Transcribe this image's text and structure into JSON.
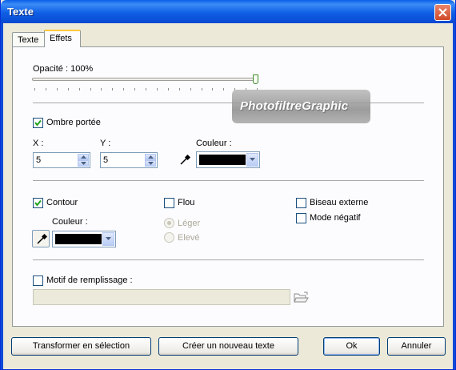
{
  "window": {
    "title": "Texte"
  },
  "tabs": [
    {
      "label": "Texte"
    },
    {
      "label": "Effets"
    }
  ],
  "opacity": {
    "label": "Opacité : 100%",
    "value_percent": 100
  },
  "watermark": {
    "text": "PhotofiltreGraphic"
  },
  "shadow": {
    "checkbox_label": "Ombre portée",
    "checked": true,
    "x_label": "X :",
    "x_value": "5",
    "y_label": "Y :",
    "y_value": "5",
    "color_label": "Couleur :",
    "color": "#000000"
  },
  "outline": {
    "checkbox_label": "Contour",
    "checked": true,
    "color_label": "Couleur :",
    "color": "#000000"
  },
  "blur": {
    "checkbox_label": "Flou",
    "checked": false,
    "options": [
      {
        "label": "Léger"
      },
      {
        "label": "Elevé"
      }
    ]
  },
  "bevel": {
    "checkbox_label": "Biseau externe",
    "checked": false
  },
  "negative": {
    "checkbox_label": "Mode négatif",
    "checked": false
  },
  "fill_pattern": {
    "checkbox_label": "Motif de remplissage :",
    "checked": false,
    "path": ""
  },
  "buttons": {
    "transform": "Transformer en sélection",
    "new_text": "Créer un nouveau texte",
    "ok": "Ok",
    "cancel": "Annuler"
  },
  "colors": {
    "titlebar": "#0a5ee8",
    "dialog_bg": "#ece9d8",
    "tab_highlight": "#ffc83c",
    "checkbox_border": "#1c5180"
  }
}
